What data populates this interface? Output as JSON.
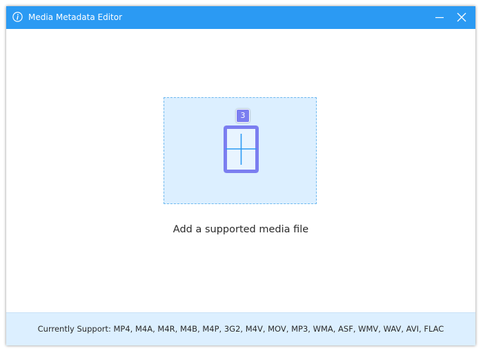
{
  "window": {
    "title": "Media Metadata Editor",
    "title_icon": "info-icon",
    "controls": {
      "minimize_icon": "minimize-icon",
      "close_icon": "close-icon"
    }
  },
  "dropzone": {
    "icon": "add-file-plus-icon",
    "badge": "3",
    "prompt": "Add a supported media file"
  },
  "footer": {
    "support_text": "Currently Support: MP4, M4A, M4R, M4B, M4P, 3G2, M4V, MOV, MP3, WMA, ASF, WMV, WAV, AVI, FLAC"
  },
  "colors": {
    "titlebar": "#2b9af3",
    "dropzone_fill": "#dcefff",
    "dropzone_border": "#6cb8ef",
    "accent_purple": "#7b7ef0",
    "plus_stroke": "#2b9af3"
  }
}
